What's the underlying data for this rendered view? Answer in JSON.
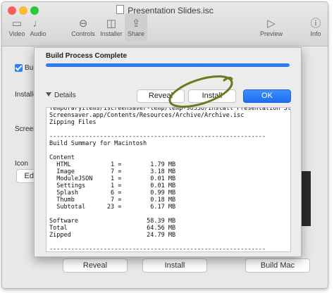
{
  "window": {
    "title": "Presentation Slides.isc",
    "toolbar": [
      {
        "label": "Video",
        "icon": "video-icon"
      },
      {
        "label": "Audio",
        "icon": "audio-icon"
      },
      {
        "label": "Controls",
        "icon": "controls-icon"
      },
      {
        "label": "Installer",
        "icon": "installer-icon"
      },
      {
        "label": "Share",
        "icon": "share-icon"
      },
      {
        "label": "Preview",
        "icon": "preview-icon"
      },
      {
        "label": "Info",
        "icon": "info-icon"
      }
    ]
  },
  "background": {
    "checkbox_label": "Bui",
    "installer_label": "Installe",
    "screen_label": "Screen",
    "icon_label": "Icon",
    "edit_button": "Edit",
    "reveal_button": "Reveal",
    "install_button": "Install",
    "build_button": "Build Mac"
  },
  "sheet": {
    "title": "Build Process Complete",
    "progress": 1.0,
    "details_label": "Details",
    "reveal_button": "Reveal",
    "install_button": "Install",
    "ok_button": "OK",
    "log_lines": [
      "Temporaryitems/iscreensaver-temp/temp-90558/install Presentation Slides",
      "Screensaver.app/Contents/Resources/Archive/Archive.isc",
      "Zipping Files",
      "",
      "------------------------------------------------------------",
      "Build Summary for Macintosh",
      "",
      "Content",
      "  HTML           1 =        1.79 MB",
      "  Image          7 =        3.18 MB",
      "  ModuleJSON     1 =        0.01 MB",
      "  Settings       1 =        0.01 MB",
      "  Splash         6 =        0.99 MB",
      "  Thumb          7 =        0.18 MB",
      "  Subtotal      23 =        6.17 MB",
      "",
      "Software                   58.39 MB",
      "Total                      64.56 MB",
      "Zipped                     24.79 MB",
      "",
      "------------------------------------------------------------"
    ]
  },
  "colors": {
    "accent": "#2f7bf5",
    "annotation": "#6a7a1c",
    "close": "#fc5f57",
    "minimize": "#fdbc2e",
    "zoom": "#28c840"
  }
}
